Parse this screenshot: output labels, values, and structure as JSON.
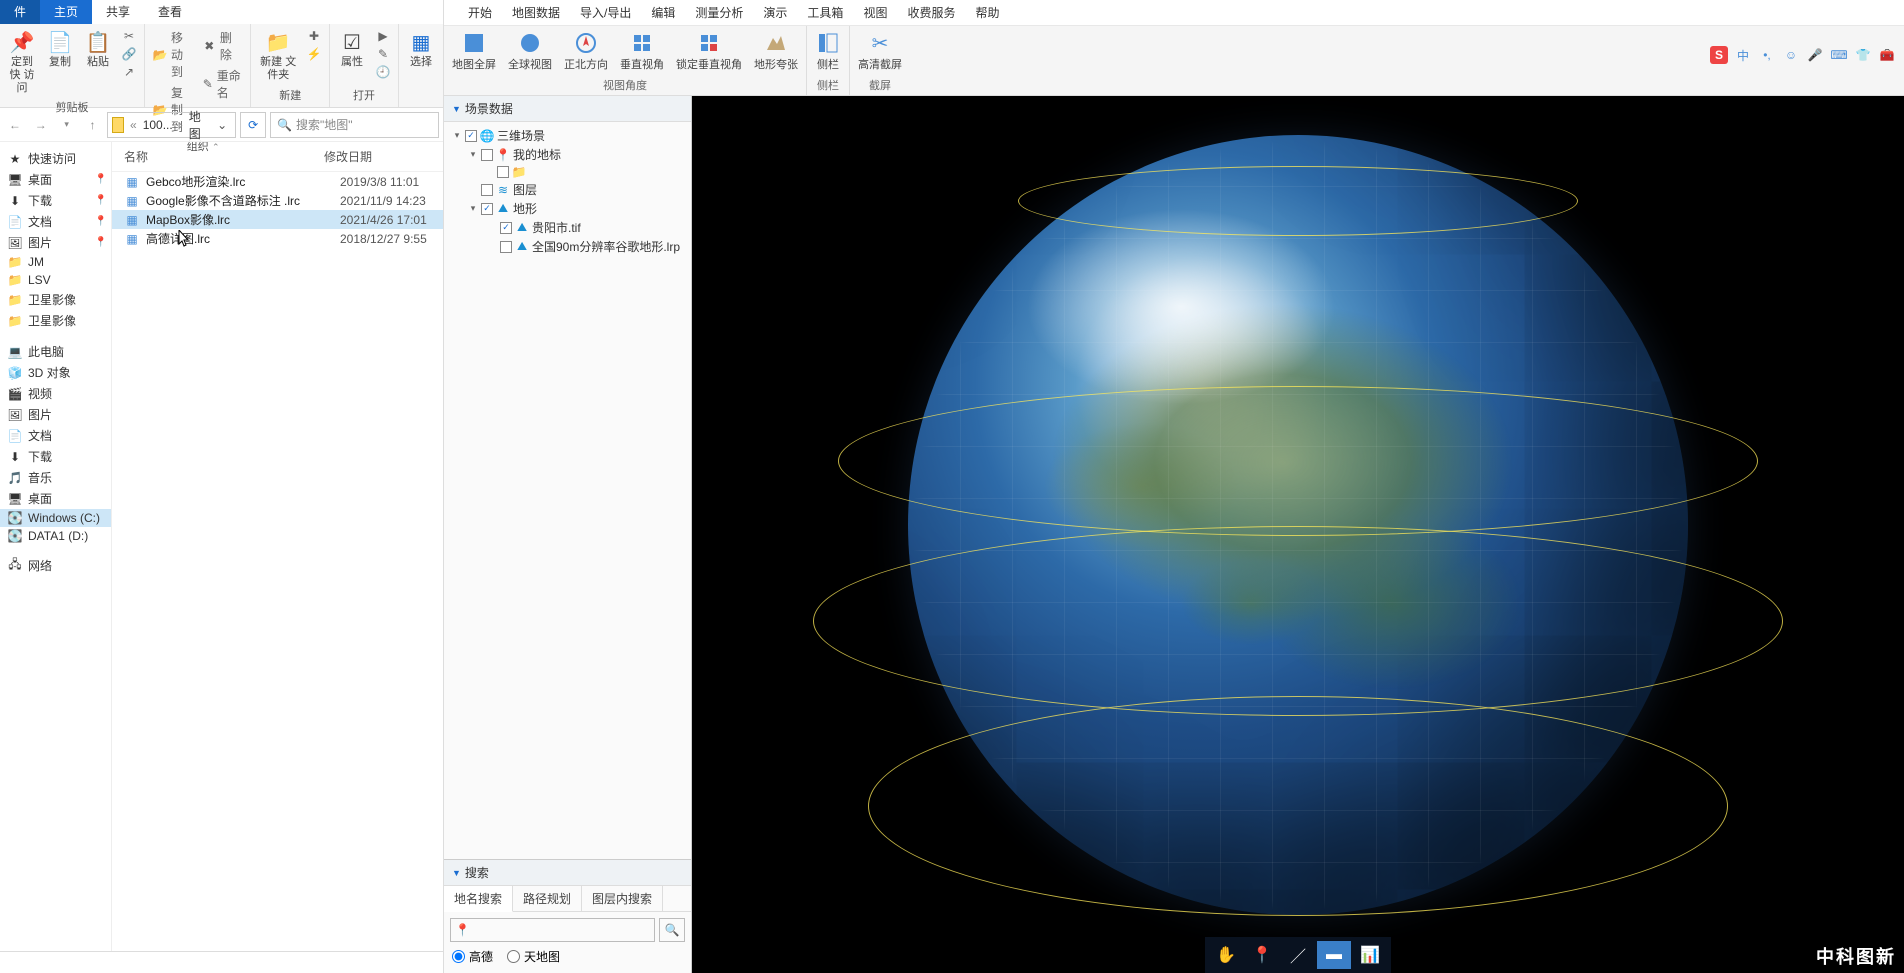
{
  "explorer": {
    "tabs": {
      "file": "件",
      "home": "主页",
      "share": "共享",
      "view": "查看"
    },
    "ribbon": {
      "pin": "定到快\n访问",
      "copy": "复制",
      "paste": "粘贴",
      "moveTo": "移动到",
      "copyTo": "复制到",
      "delete": "删除",
      "rename": "重命名",
      "newFolder": "新建\n文件夹",
      "properties": "属性",
      "select": "选择",
      "grpClipboard": "剪贴板",
      "grpOrganize": "组织",
      "grpNew": "新建",
      "grpOpen": "打开"
    },
    "breadcrumb": {
      "p1": "100...",
      "p2": "地图"
    },
    "searchPlaceholder": "搜索\"地图\"",
    "columns": {
      "name": "名称",
      "date": "修改日期"
    },
    "files": [
      {
        "name": "Gebco地形渲染.lrc",
        "date": "2019/3/8 11:01"
      },
      {
        "name": "Google影像不含道路标注 .lrc",
        "date": "2021/11/9 14:23"
      },
      {
        "name": "MapBox影像.lrc",
        "date": "2021/4/26 17:01"
      },
      {
        "name": "高德详图.lrc",
        "date": "2018/12/27 9:55"
      }
    ],
    "nav": {
      "quick": "快速访问",
      "desktop": "桌面",
      "downloads": "下载",
      "documents": "文档",
      "pictures": "图片",
      "jm": "JM",
      "lsv": "LSV",
      "sat1": "卫星影像",
      "sat2": "卫星影像",
      "thispc": "此电脑",
      "objects3d": "3D 对象",
      "videos": "视频",
      "pictures2": "图片",
      "documents2": "文档",
      "downloads2": "下载",
      "music": "音乐",
      "desktop2": "桌面",
      "cdrive": "Windows (C:)",
      "ddrive": "DATA1 (D:)",
      "network": "网络"
    }
  },
  "gis": {
    "menu": [
      "开始",
      "地图数据",
      "导入/导出",
      "编辑",
      "测量分析",
      "演示",
      "工具箱",
      "视图",
      "收费服务",
      "帮助"
    ],
    "ribbon": {
      "fullMap": "地图全屏",
      "globalView": "全球视图",
      "northUp": "正北方向",
      "vertical": "垂直视角",
      "lockVertical": "锁定垂直视角",
      "exaggerate": "地形夸张",
      "sidebar": "侧栏",
      "screenshot": "高清截屏",
      "grpView": "视图角度",
      "grpSide": "侧栏",
      "grpShot": "截屏"
    },
    "ime": {
      "lang": "中"
    },
    "scene": {
      "title": "场景数据",
      "root": "三维场景",
      "myPlaces": "我的地标",
      "layers": "图层",
      "terrain": "地形",
      "terrainItems": [
        "贵阳市.tif",
        "全国90m分辨率谷歌地形.lrp"
      ]
    },
    "search": {
      "title": "搜索",
      "tabs": [
        "地名搜索",
        "路径规划",
        "图层内搜索"
      ],
      "providers": {
        "gaode": "高德",
        "tianditu": "天地图"
      }
    },
    "watermark": "中科图新"
  }
}
